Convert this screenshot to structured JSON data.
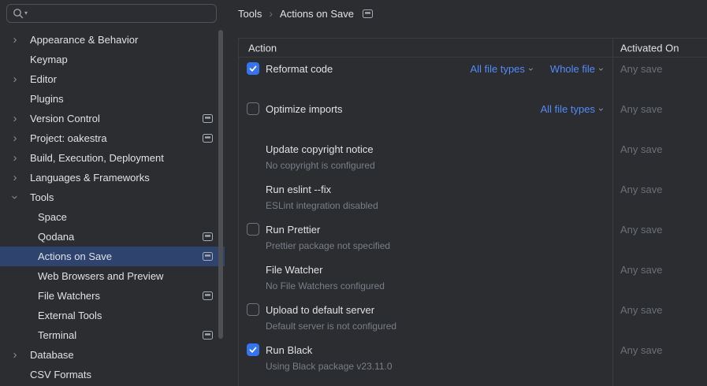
{
  "colors": {
    "background": "#2B2D30",
    "selection_blue": "#2E436E",
    "checkbox_accent": "#3574F0",
    "link_blue": "#548AF7",
    "border": "#3A3C41",
    "text_primary": "#DFE1E5",
    "text_secondary": "#7A7E87",
    "text_disabled": "#6C6F76"
  },
  "sidebar": {
    "search": {
      "value": "",
      "placeholder": ""
    },
    "items": [
      {
        "label": "Appearance & Behavior",
        "level": 1,
        "chevron": "right",
        "per_project_icon": false,
        "selected": false
      },
      {
        "label": "Keymap",
        "level": 1,
        "chevron": null,
        "per_project_icon": false,
        "selected": false
      },
      {
        "label": "Editor",
        "level": 1,
        "chevron": "right",
        "per_project_icon": false,
        "selected": false
      },
      {
        "label": "Plugins",
        "level": 1,
        "chevron": null,
        "per_project_icon": false,
        "selected": false
      },
      {
        "label": "Version Control",
        "level": 1,
        "chevron": "right",
        "per_project_icon": true,
        "selected": false
      },
      {
        "label": "Project: oakestra",
        "level": 1,
        "chevron": "right",
        "per_project_icon": true,
        "selected": false
      },
      {
        "label": "Build, Execution, Deployment",
        "level": 1,
        "chevron": "right",
        "per_project_icon": false,
        "selected": false
      },
      {
        "label": "Languages & Frameworks",
        "level": 1,
        "chevron": "right",
        "per_project_icon": false,
        "selected": false
      },
      {
        "label": "Tools",
        "level": 1,
        "chevron": "down",
        "per_project_icon": false,
        "selected": false
      },
      {
        "label": "Space",
        "level": 2,
        "chevron": null,
        "per_project_icon": false,
        "selected": false
      },
      {
        "label": "Qodana",
        "level": 2,
        "chevron": null,
        "per_project_icon": true,
        "selected": false
      },
      {
        "label": "Actions on Save",
        "level": 2,
        "chevron": null,
        "per_project_icon": true,
        "selected": true
      },
      {
        "label": "Web Browsers and Preview",
        "level": 2,
        "chevron": null,
        "per_project_icon": false,
        "selected": false
      },
      {
        "label": "File Watchers",
        "level": 2,
        "chevron": null,
        "per_project_icon": true,
        "selected": false
      },
      {
        "label": "External Tools",
        "level": 2,
        "chevron": null,
        "per_project_icon": false,
        "selected": false
      },
      {
        "label": "Terminal",
        "level": 2,
        "chevron": null,
        "per_project_icon": true,
        "selected": false
      },
      {
        "label": "Database",
        "level": 1,
        "chevron": "right",
        "per_project_icon": false,
        "selected": false
      },
      {
        "label": "CSV Formats",
        "level": 1,
        "chevron": null,
        "per_project_icon": false,
        "selected": false
      }
    ]
  },
  "breadcrumb": {
    "part1": "Tools",
    "separator": "›",
    "part2": "Actions on Save"
  },
  "table": {
    "header": {
      "action": "Action",
      "activated_on": "Activated On"
    },
    "rows": [
      {
        "title": "Reformat code",
        "checkbox": "checked",
        "subtitle": "",
        "dropdowns": [
          "All file types",
          "Whole file"
        ],
        "activated": "Any save"
      },
      {
        "title": "Optimize imports",
        "checkbox": "unchecked",
        "subtitle": "",
        "dropdowns": [
          "All file types"
        ],
        "activated": "Any save"
      },
      {
        "title": "Update copyright notice",
        "checkbox": "none",
        "subtitle": "No copyright is configured",
        "dropdowns": [],
        "activated": "Any save"
      },
      {
        "title": "Run eslint --fix",
        "checkbox": "none",
        "subtitle": "ESLint integration disabled",
        "dropdowns": [],
        "activated": "Any save"
      },
      {
        "title": "Run Prettier",
        "checkbox": "unchecked",
        "subtitle": "Prettier package not specified",
        "dropdowns": [],
        "activated": "Any save"
      },
      {
        "title": "File Watcher",
        "checkbox": "none",
        "subtitle": "No File Watchers configured",
        "dropdowns": [],
        "activated": "Any save"
      },
      {
        "title": "Upload to default server",
        "checkbox": "unchecked",
        "subtitle": "Default server is not configured",
        "dropdowns": [],
        "activated": "Any save"
      },
      {
        "title": "Run Black",
        "checkbox": "checked",
        "subtitle": "Using Black package v23.11.0",
        "dropdowns": [],
        "activated": "Any save"
      }
    ]
  }
}
